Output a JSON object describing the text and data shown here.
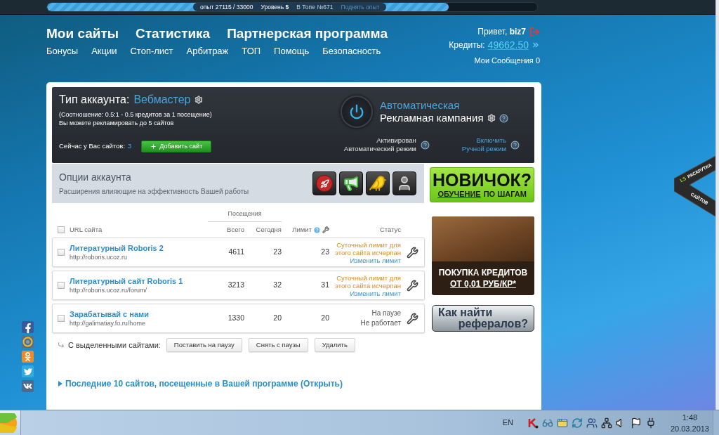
{
  "top_bar": {
    "experience": "опыт 27115 / 33000",
    "level_label": "Уровень **5**",
    "rank": "В Топе №671",
    "raise_link": "Поднять опыт",
    "level": 0.82
  },
  "nav": {
    "main": [
      "Мои сайты",
      "Статистика",
      "Партнерская программа"
    ],
    "sub": [
      "Бонусы",
      "Акции",
      "Стоп-лист",
      "Арбитраж",
      "ТОП",
      "Помощь",
      "Безопасность"
    ]
  },
  "user": {
    "greeting": "Привет, **biz7**",
    "credits_label": "Кредиты:",
    "credits": "49662.50",
    "messages": "Мои Сообщения 0"
  },
  "account": {
    "title": "Тип аккаунта:",
    "type": "Вебмастер",
    "ratio": "(Соотношение: 0.5:1 - 0.5 кредитов за 1 посещение)",
    "limit_note": "Вы можете рекламировать до 5 сайтов",
    "sites_label": "Сейчас у Вас сайтов:",
    "sites_count": "3",
    "add_button": "Добавить сайт"
  },
  "campaign": {
    "title": "Автоматическая",
    "subtitle": "Рекламная кампания",
    "modes": [
      {
        "kind": "status",
        "lines": [
          "Активирован",
          "Автоматический режим"
        ]
      },
      {
        "kind": "link",
        "lines": [
          "Включить",
          "Ручной режим"
        ]
      }
    ]
  },
  "options": {
    "title": "Опции аккаунта",
    "description": "Расширения влияющие на эффективность Вашей работы"
  },
  "promos": {
    "beginner": {
      "title": "НОВИЧОК?",
      "link": "ОБУЧЕНИЕ",
      "rest": "ПО ШАГАМ"
    },
    "credits": {
      "title": "ПОКУПКА КРЕДИТОВ",
      "price": "ОТ 0,01 РУБ/КР*"
    },
    "referrals": {
      "lines": [
        "Как найти",
        "рефералов?"
      ]
    }
  },
  "table": {
    "group_header": "Посещения",
    "columns": [
      "URL сайта",
      "Всего",
      "Сегодня",
      "Лимит",
      "Статус"
    ],
    "select_all": {
      "checked": false
    },
    "rows": [
      {
        "name": "Литературный Roboris 2",
        "url": "http://roboris.ucoz.ru",
        "total": "4611",
        "today": "23",
        "limit": "23",
        "checked": false,
        "status": [
          {
            "kind": "warning",
            "text": "Суточный лимит для этого сайта исчерпан"
          },
          {
            "kind": "link",
            "text": "Изменить лимит"
          }
        ]
      },
      {
        "name": "Литературный сайт Roboris 1",
        "url": "http://roboris.ucoz.ru/forum/",
        "total": "3213",
        "today": "32",
        "limit": "31",
        "checked": false,
        "status": [
          {
            "kind": "warning",
            "text": "Суточный лимит для этого сайта исчерпан"
          },
          {
            "kind": "link",
            "text": "Изменить лимит"
          }
        ]
      },
      {
        "name": "Зарабатывай с нами",
        "url": "http://galimatiay.fo.ru/home",
        "total": "1330",
        "today": "20",
        "limit": "20",
        "checked": false,
        "status": [
          {
            "kind": "plain",
            "text": "На паузе"
          },
          {
            "kind": "plain",
            "text": "Не работает"
          }
        ]
      }
    ]
  },
  "bulk_actions": {
    "label": "С выделенными сайтами:",
    "buttons": [
      "Поставить на паузу",
      "Снять с паузы",
      "Удалить"
    ]
  },
  "recent": {
    "label": "Последние 10 сайтов, посещенные в Вашей программе (Открыть)",
    "expanded": false
  },
  "ribbon": {
    "logo": "LS",
    "lines": [
      "РАСКРУТКА",
      "САЙТОВ"
    ]
  },
  "taskbar": {
    "language": "EN",
    "time": "1:48",
    "date": "20.03.2013"
  }
}
